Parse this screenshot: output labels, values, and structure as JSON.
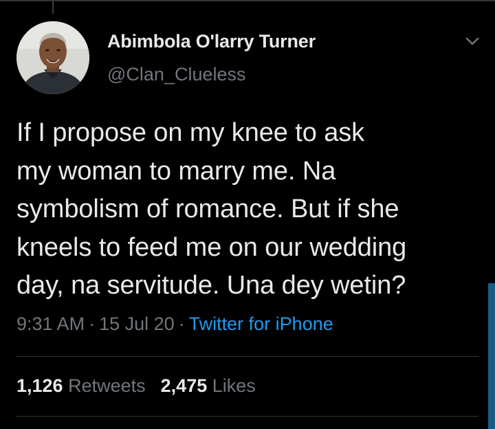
{
  "tweet": {
    "author": {
      "display_name": "Abimbola O'larry Turner",
      "handle": "@Clan_Clueless"
    },
    "text": "If I propose on my knee to ask\nmy woman to marry me. Na\nsymbolism of romance. But if she\nkneels to feed me on our wedding\nday, na servitude. Una dey wetin?",
    "time": "9:31 AM",
    "date": "15 Jul 20",
    "separator": "·",
    "source": "Twitter for iPhone",
    "retweets": {
      "count": "1,126",
      "label": "Retweets"
    },
    "likes": {
      "count": "2,475",
      "label": "Likes"
    }
  },
  "icons": {
    "menu": "chevron-down-icon",
    "avatar": "profile-photo"
  },
  "colors": {
    "background": "#000000",
    "text": "#e7e9ea",
    "muted": "#71767b",
    "link": "#1d9bf0",
    "divider": "#2f3336",
    "scrollbar": "#1b5c82"
  }
}
